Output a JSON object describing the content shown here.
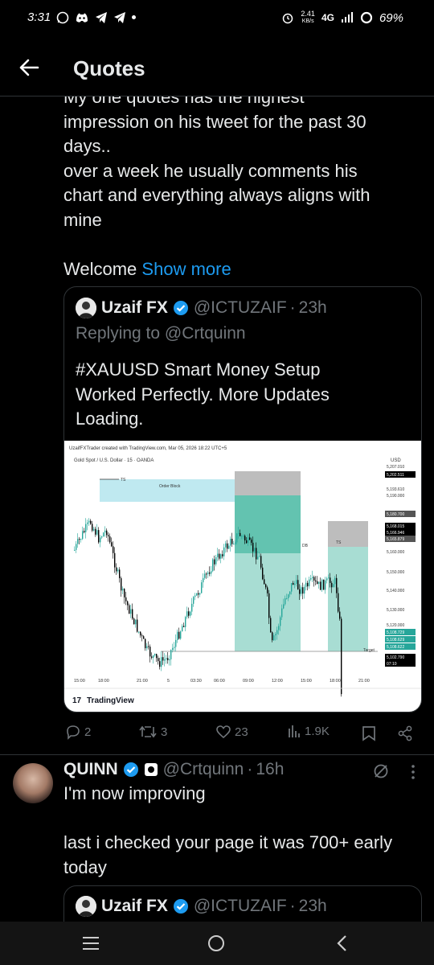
{
  "status_bar": {
    "time": "3:31",
    "speed_top": "2.41",
    "speed_unit": "KB/s",
    "network": "4G",
    "battery": "69%"
  },
  "header": {
    "title": "Quotes"
  },
  "post": {
    "text_lines": [
      "My one quotes has the highest",
      "impression on his tweet for the past 30",
      "days..",
      "over a week he usually comments his",
      "chart and everything always aligns with",
      "mine",
      "",
      "Welcome"
    ],
    "show_more": "Show more",
    "quoted": {
      "name": "Uzaif FX",
      "handle": "@ICTUZAIF",
      "dot": "·",
      "time": "23h",
      "reply_to": "Replying to @Crtquinn",
      "text_lines": [
        "#XAUUSD Smart Money Setup",
        "Worked Perfectly. More Updates",
        "Loading."
      ],
      "chart_data": {
        "type": "candlestick",
        "header": "UzaifFXTrader created with TradingView.com, Mar 05, 2026 18:22 UTC+5",
        "symbol": "Gold Spot / U.S. Dollar · 15 · OANDA",
        "currency": "USD",
        "y_ticks": [
          "5,207.010",
          "5,202.511",
          "5,193.610",
          "5,190.000",
          "5,180.700",
          "5,168.015",
          "5,166.946",
          "5,165.879",
          "5,160.000",
          "5,150.000",
          "5,140.000",
          "5,130.000",
          "5,120.000",
          "5,108.729",
          "5,108.629",
          "5,108.622",
          "5,102.790",
          "07:10"
        ],
        "x_ticks": [
          "15:00",
          "18:00",
          "21:00",
          "5",
          "03:30",
          "06:00",
          "09:00",
          "12:00",
          "15:00",
          "18:00",
          "21:00"
        ],
        "annotations": [
          "TS",
          "Order Block",
          "DB",
          "TS",
          "Target"
        ],
        "brand": "TradingView"
      }
    },
    "actions": {
      "replies": "2",
      "reposts": "3",
      "likes": "23",
      "views": "1.9K"
    }
  },
  "post2": {
    "name": "QUINN",
    "handle": "@Crtquinn",
    "dot": "·",
    "time": "16h",
    "text_lines": [
      "I'm now improving",
      "",
      "last i checked your page it was 700+ early",
      "today"
    ],
    "quoted": {
      "name": "Uzaif FX",
      "handle": "@ICTUZAIF",
      "dot": "·",
      "time": "23h"
    }
  },
  "colors": {
    "accent": "#1d9bf0",
    "background": "#000000",
    "muted": "#71767b",
    "bull": "#26a69a",
    "bear": "#000000"
  }
}
